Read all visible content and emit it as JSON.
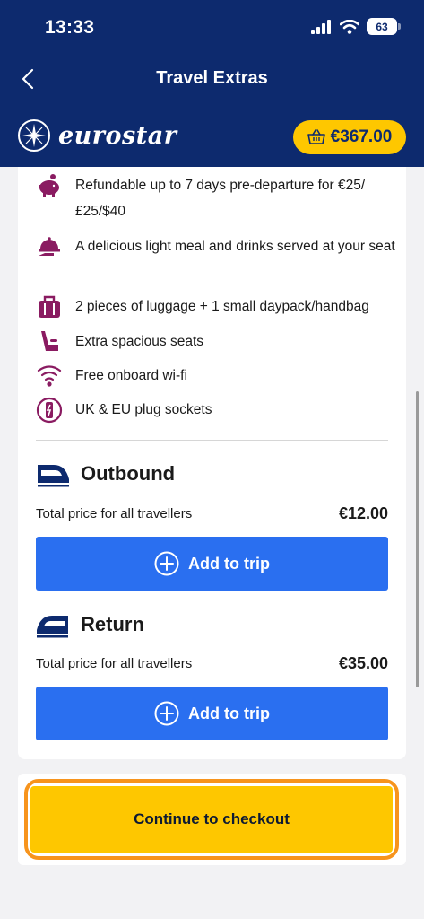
{
  "status_bar": {
    "time": "13:33",
    "battery": "63"
  },
  "nav": {
    "title": "Travel Extras",
    "back_icon": "chevron-left-icon"
  },
  "brand": {
    "name": "eurostar",
    "basket_total": "€367.00"
  },
  "features": [
    {
      "icon": "piggy-bank-icon",
      "text": "Refundable up to 7 days pre-departure for €25/£25/$40"
    },
    {
      "icon": "meal-service-icon",
      "text": "A delicious light meal and drinks served at your seat"
    },
    {
      "icon": "luggage-icon",
      "text": "2 pieces of luggage + 1 small daypack/handbag"
    },
    {
      "icon": "seat-icon",
      "text": "Extra spacious seats"
    },
    {
      "icon": "wifi-icon",
      "text": "Free onboard wi-fi"
    },
    {
      "icon": "plug-icon",
      "text": "UK & EU plug sockets"
    }
  ],
  "outbound": {
    "title": "Outbound",
    "price_label": "Total price for all travellers",
    "price": "€12.00",
    "button": "Add to trip"
  },
  "return": {
    "title": "Return",
    "price_label": "Total price for all travellers",
    "price": "€35.00",
    "button": "Add to trip"
  },
  "checkout": {
    "label": "Continue to checkout"
  },
  "colors": {
    "header": "#0d2a6e",
    "accent_yellow": "#fec700",
    "button_blue": "#2a6ff0",
    "icon_purple": "#8a1b61",
    "focus_orange": "#f7941d"
  }
}
